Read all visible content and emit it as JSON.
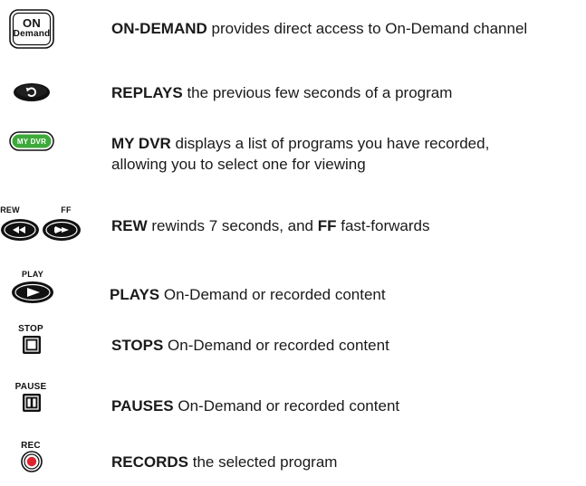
{
  "buttons": {
    "ondemand": {
      "label_line1": "ON",
      "label_line2": "Demand",
      "term": "ON-DEMAND",
      "rest": " provides direct access to On-Demand channel"
    },
    "replay": {
      "term": "REPLAYS",
      "rest": " the previous few seconds of a program"
    },
    "mydvr": {
      "label": "MY DVR",
      "term": "MY DVR",
      "rest_line1": " displays a list of programs you have recorded,",
      "rest_line2": "allowing you to select one for viewing",
      "color": "#3daa3a"
    },
    "rewff": {
      "rew_cap": "REW",
      "ff_cap": "FF",
      "term1": "REW",
      "mid": " rewinds 7 seconds, and ",
      "term2": "FF",
      "rest": " fast-forwards"
    },
    "play": {
      "cap": "PLAY",
      "term": "PLAYS",
      "rest": " On-Demand or recorded content"
    },
    "stop": {
      "cap": "STOP",
      "term": "STOPS",
      "rest": " On-Demand or recorded content"
    },
    "pause": {
      "cap": "PAUSE",
      "term": "PAUSES",
      "rest": " On-Demand or recorded content"
    },
    "rec": {
      "cap": "REC",
      "term": "RECORDS",
      "rest": " the selected program",
      "color": "#e0242e"
    }
  }
}
